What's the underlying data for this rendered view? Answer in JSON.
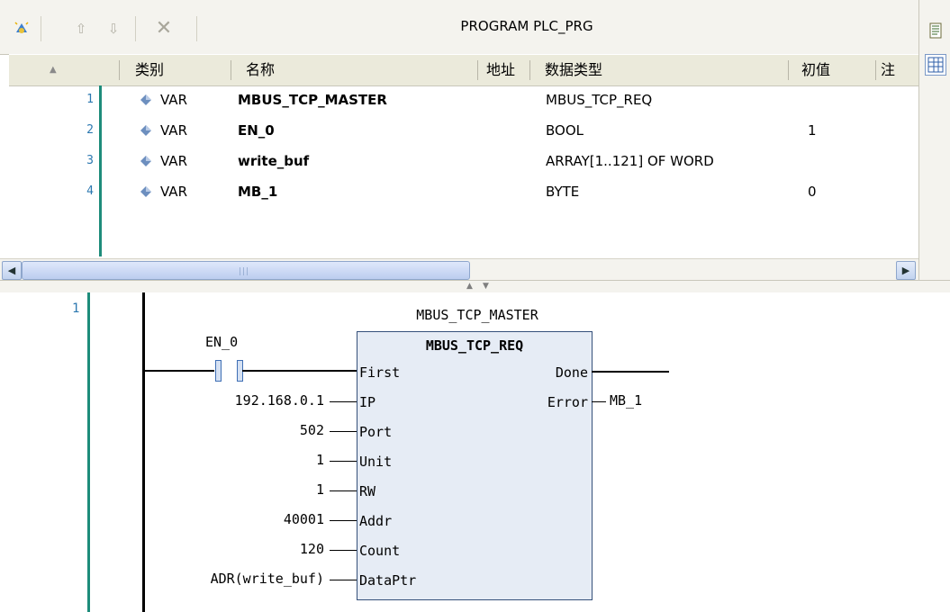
{
  "toolbar": {
    "title": "PROGRAM PLC_PRG"
  },
  "var_table": {
    "headers": [
      "类别",
      "名称",
      "地址",
      "数据类型",
      "初值",
      "注"
    ],
    "rows": [
      {
        "line": "1",
        "kind": "VAR",
        "name": "MBUS_TCP_MASTER",
        "type": "MBUS_TCP_REQ",
        "init": ""
      },
      {
        "line": "2",
        "kind": "VAR",
        "name": "EN_0",
        "type": "BOOL",
        "init": "1"
      },
      {
        "line": "3",
        "kind": "VAR",
        "name": "write_buf",
        "type": "ARRAY[1..121] OF WORD",
        "init": ""
      },
      {
        "line": "4",
        "kind": "VAR",
        "name": "MB_1",
        "type": "BYTE",
        "init": "0"
      }
    ]
  },
  "ladder": {
    "network_number": "1",
    "instance_name": "MBUS_TCP_MASTER",
    "fb_type": "MBUS_TCP_REQ",
    "contact_label": "EN_0",
    "inputs": [
      {
        "pin": "First",
        "value": ""
      },
      {
        "pin": "IP",
        "value": "192.168.0.1"
      },
      {
        "pin": "Port",
        "value": "502"
      },
      {
        "pin": "Unit",
        "value": "1"
      },
      {
        "pin": "RW",
        "value": "1"
      },
      {
        "pin": "Addr",
        "value": "40001"
      },
      {
        "pin": "Count",
        "value": "120"
      },
      {
        "pin": "DataPtr",
        "value": "ADR(write_buf)"
      }
    ],
    "outputs": [
      {
        "pin": "Done",
        "value": ""
      },
      {
        "pin": "Error",
        "value": "MB_1"
      }
    ]
  },
  "colors": {
    "gutter_line": "#1e8c7b",
    "line_numbers": "#2c78b0",
    "fb_fill": "#e6ecf5",
    "fb_border": "#35507a",
    "contact": "#3f6fb5"
  },
  "icons": [
    "new-var-icon",
    "move-up-icon",
    "move-down-icon",
    "delete-icon",
    "text-view-icon",
    "table-view-icon",
    "var-diamond-icon",
    "scroll-left-icon",
    "scroll-right-icon"
  ]
}
